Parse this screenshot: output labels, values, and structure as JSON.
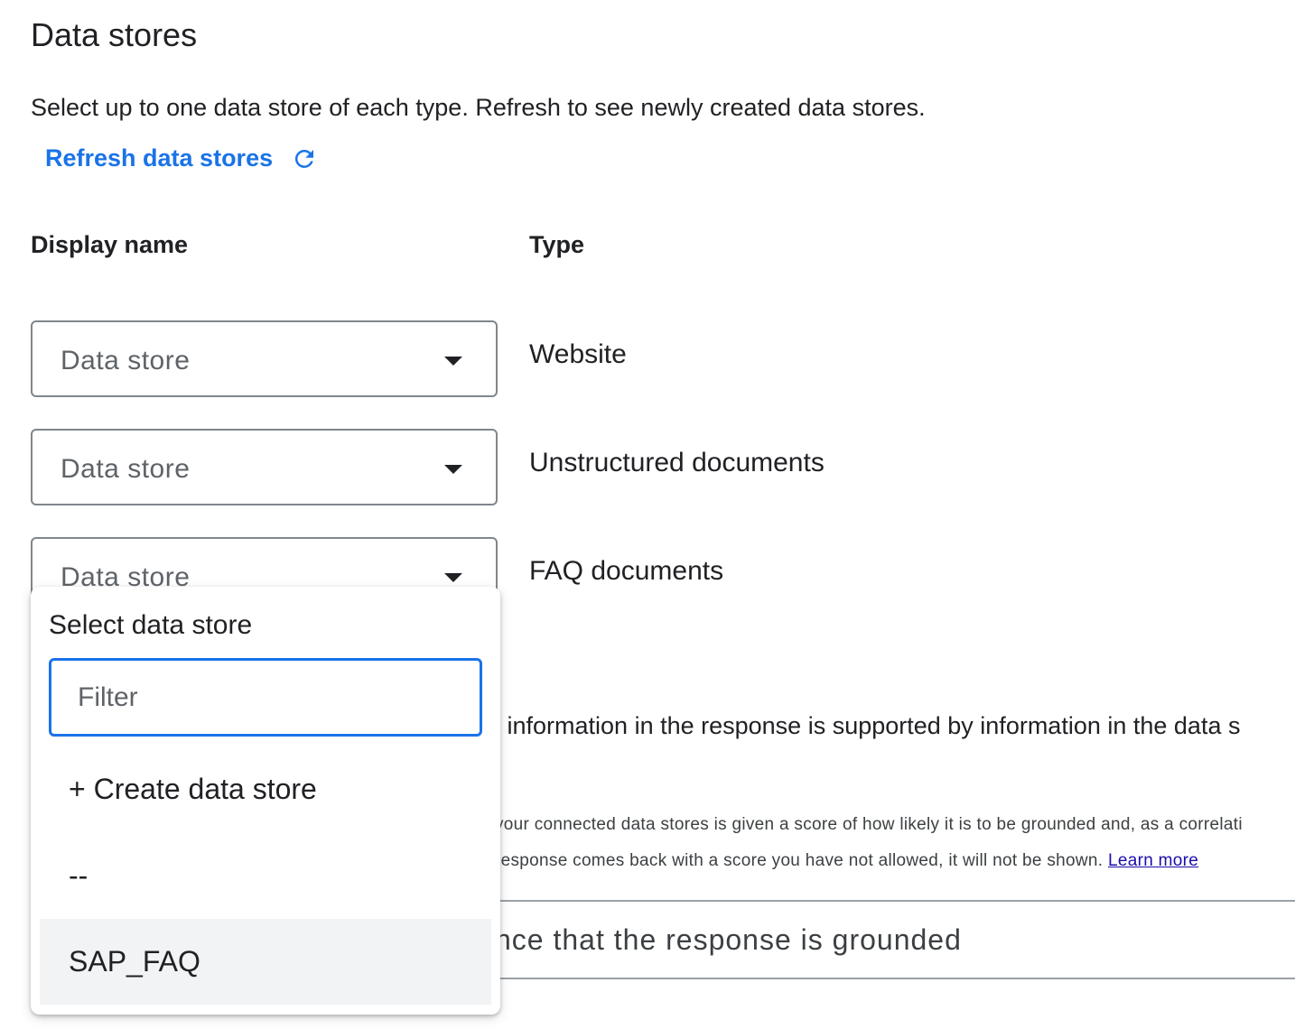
{
  "section": {
    "title": "Data stores",
    "description": "Select up to one data store of each type. Refresh to see newly created data stores.",
    "refresh_label": "Refresh data stores"
  },
  "table": {
    "headers": {
      "display_name": "Display name",
      "type": "Type"
    },
    "rows": [
      {
        "select_placeholder": "Data store",
        "type": "Website"
      },
      {
        "select_placeholder": "Data store",
        "type": "Unstructured documents"
      },
      {
        "select_placeholder": "Data store",
        "type": "FAQ documents"
      }
    ]
  },
  "background": {
    "grounding_text": "l information in the response is supported by information in the data s",
    "help_line1": "your connected data stores is given a score of how likely it is to be grounded and, as a correlati",
    "help_line2": "response comes back with a score you have not allowed, it will not be shown.",
    "learn_more": "Learn more",
    "field_label": "nce that the response is grounded"
  },
  "dropdown": {
    "title": "Select data store",
    "filter_placeholder": "Filter",
    "options": [
      {
        "label": "+ Create data store"
      },
      {
        "label": "--"
      },
      {
        "label": "SAP_FAQ"
      }
    ]
  },
  "colors": {
    "link": "#1a73e8",
    "focus": "#1a73e8",
    "border": "#80868b",
    "highlight": "#f1f3f4"
  },
  "icons": {
    "refresh": "refresh-icon",
    "dropdown_arrow": "arrow-drop-down-icon"
  }
}
